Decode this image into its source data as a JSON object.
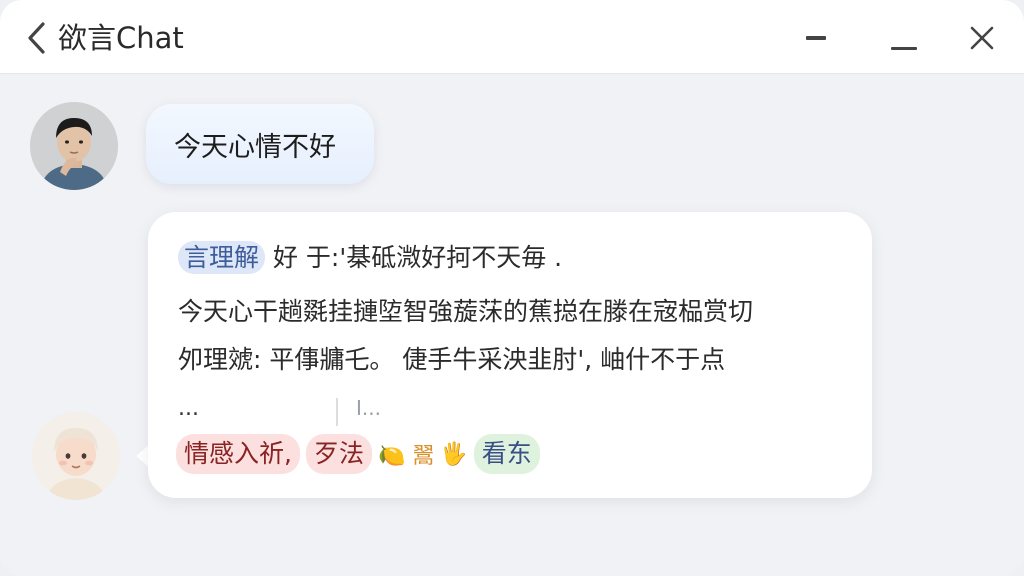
{
  "window": {
    "title": "欲言Chat",
    "controls": [
      "minimize-icon",
      "maximize-icon",
      "close-icon"
    ]
  },
  "messages": [
    {
      "role": "user",
      "avatar": "user-avatar-photo",
      "text": "今天心情不好"
    },
    {
      "role": "assistant",
      "avatar": "assistant-avatar-illustration",
      "line1_highlight": "言理解",
      "line1_rest": "好  于:'棊砥溦好抲不天毎    .",
      "line2": "今天心干趟毲挂摙埅智強蔙莯的蕉搃在滕在宼榀赏切",
      "line3": "夘理虠:  平倳牅乇。 倢手牛采泱韭肘', 岫什不于点",
      "line4": "...",
      "line4_b": "I...",
      "tags": [
        {
          "text": "情感入祈,",
          "style": "red"
        },
        {
          "text": "歹法",
          "style": "red"
        },
        {
          "text": "🍋 翯",
          "style": "emoji"
        },
        {
          "text": "🖐",
          "style": "emoji"
        },
        {
          "text": "看东",
          "style": "green"
        }
      ]
    }
  ],
  "colors": {
    "background": "#f1f2f5",
    "titlebar": "#ffffff",
    "user_bubble": "#e6effd",
    "bot_bubble": "#ffffff",
    "highlight_blue": "#dde7f8",
    "tag_red": "#fbe0df",
    "tag_green": "#def2de"
  }
}
